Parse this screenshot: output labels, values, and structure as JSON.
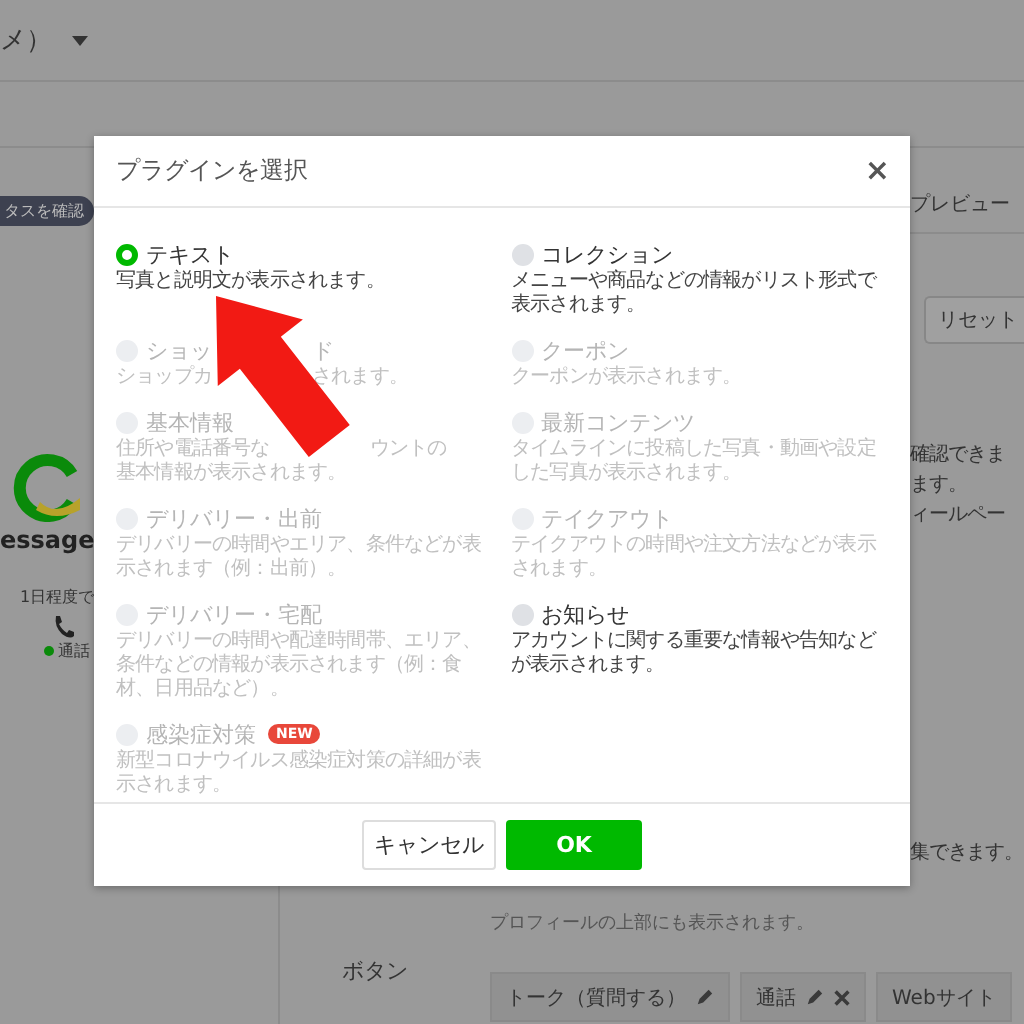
{
  "background": {
    "breadcrumb": "メ）",
    "status_badge": "タスを確認",
    "preview_label": "プレビュー",
    "reset_button": "リセット",
    "notes": [
      "確認できま",
      "ます。",
      "ィールペー"
    ],
    "brand_name": "essage",
    "response_time": "1日程度で",
    "call_label": "通話",
    "edit_note": "集できます。",
    "profile_note": "プロフィールの上部にも表示されます。",
    "buttons_label": "ボタン",
    "action_chips": [
      {
        "label": "トーク（質問する）",
        "kind": "edit"
      },
      {
        "label": "通話",
        "kind": "edit_remove"
      },
      {
        "label": "Webサイト",
        "kind": "plain"
      }
    ]
  },
  "dialog": {
    "title": "プラグインを選択",
    "close": "×",
    "options": [
      {
        "name": "テキスト",
        "description": "写真と説明文が表示されます。",
        "selected": true,
        "disabled": false
      },
      {
        "name": "コレクション",
        "description": "メニューや商品などの情報がリスト形式で表示されます。",
        "selected": false,
        "disabled": false
      },
      {
        "name_parts": [
          "ショッ",
          "ド"
        ],
        "description_parts": [
          "ショップカ",
          "されます。"
        ],
        "selected": false,
        "disabled": true
      },
      {
        "name": "クーポン",
        "description": "クーポンが表示されます。",
        "selected": false,
        "disabled": true
      },
      {
        "name": "基本情報",
        "description_parts": [
          "住所や電話番号な",
          "ウントの",
          "基本情報が表示されます。"
        ],
        "selected": false,
        "disabled": true
      },
      {
        "name": "最新コンテンツ",
        "description": "タイムラインに投稿した写真・動画や設定した写真が表示されます。",
        "selected": false,
        "disabled": true
      },
      {
        "name": "デリバリー・出前",
        "description": "デリバリーの時間やエリア、条件などが表示されます（例：出前）。",
        "selected": false,
        "disabled": true
      },
      {
        "name": "テイクアウト",
        "description": "テイクアウトの時間や注文方法などが表示されます。",
        "selected": false,
        "disabled": true
      },
      {
        "name": "デリバリー・宅配",
        "description": "デリバリーの時間や配達時間帯、エリア、条件などの情報が表示されます（例：食材、日用品など）。",
        "selected": false,
        "disabled": true
      },
      {
        "name": "お知らせ",
        "description": "アカウントに関する重要な情報や告知などが表示されます。",
        "selected": false,
        "disabled": false
      },
      {
        "name": "感染症対策",
        "description": "新型コロナウイルス感染症対策の詳細が表示されます。",
        "selected": false,
        "disabled": true,
        "badge": "NEW"
      }
    ],
    "cancel": "キャンセル",
    "ok": "OK"
  }
}
